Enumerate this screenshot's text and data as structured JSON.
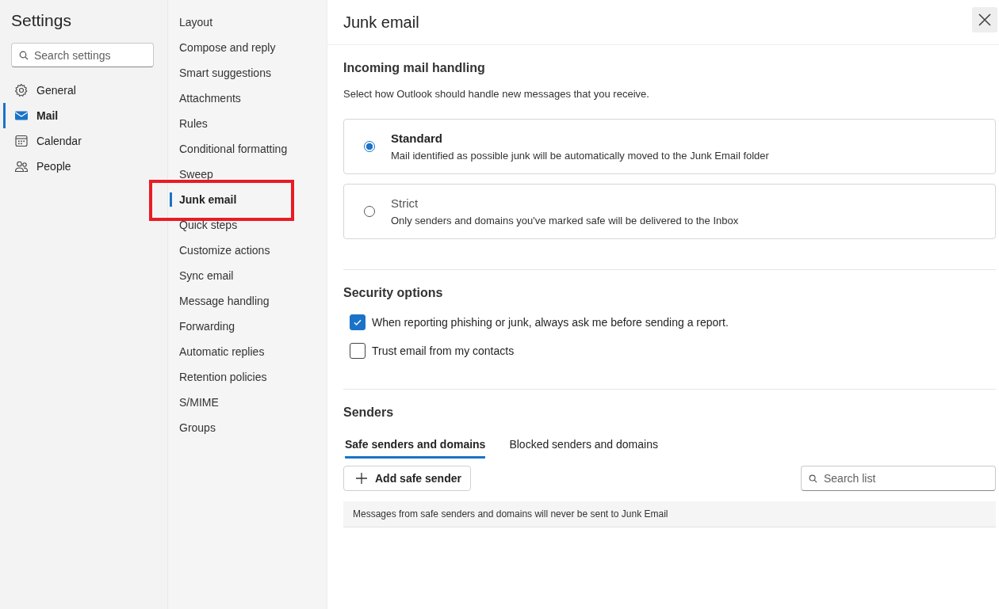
{
  "title": "Settings",
  "search": {
    "placeholder": "Search settings"
  },
  "categories": [
    {
      "label": "General",
      "kind": "gear",
      "selected": false
    },
    {
      "label": "Mail",
      "kind": "mail",
      "selected": true
    },
    {
      "label": "Calendar",
      "kind": "calendar",
      "selected": false
    },
    {
      "label": "People",
      "kind": "people",
      "selected": false
    }
  ],
  "subnav": [
    {
      "label": "Layout",
      "selected": false
    },
    {
      "label": "Compose and reply",
      "selected": false
    },
    {
      "label": "Smart suggestions",
      "selected": false
    },
    {
      "label": "Attachments",
      "selected": false
    },
    {
      "label": "Rules",
      "selected": false
    },
    {
      "label": "Conditional formatting",
      "selected": false
    },
    {
      "label": "Sweep",
      "selected": false
    },
    {
      "label": "Junk email",
      "selected": true
    },
    {
      "label": "Quick steps",
      "selected": false
    },
    {
      "label": "Customize actions",
      "selected": false
    },
    {
      "label": "Sync email",
      "selected": false
    },
    {
      "label": "Message handling",
      "selected": false
    },
    {
      "label": "Forwarding",
      "selected": false
    },
    {
      "label": "Automatic replies",
      "selected": false
    },
    {
      "label": "Retention policies",
      "selected": false
    },
    {
      "label": "S/MIME",
      "selected": false
    },
    {
      "label": "Groups",
      "selected": false
    }
  ],
  "panel": {
    "title": "Junk email",
    "incoming": {
      "heading": "Incoming mail handling",
      "description": "Select how Outlook should handle new messages that you receive.",
      "options": [
        {
          "label": "Standard",
          "description": "Mail identified as possible junk will be automatically moved to the Junk Email folder",
          "selected": true
        },
        {
          "label": "Strict",
          "description": "Only senders and domains you've marked safe will be delivered to the Inbox",
          "selected": false
        }
      ]
    },
    "security": {
      "heading": "Security options",
      "options": [
        {
          "label": "When reporting phishing or junk, always ask me before sending a report.",
          "checked": true
        },
        {
          "label": "Trust email from my contacts",
          "checked": false
        }
      ]
    },
    "senders": {
      "heading": "Senders",
      "tabs": [
        {
          "label": "Safe senders and domains",
          "selected": true
        },
        {
          "label": "Blocked senders and domains",
          "selected": false
        }
      ],
      "add_button": "Add safe sender",
      "search": {
        "placeholder": "Search list"
      },
      "info": "Messages from safe senders and domains will never be sent to Junk Email"
    }
  }
}
